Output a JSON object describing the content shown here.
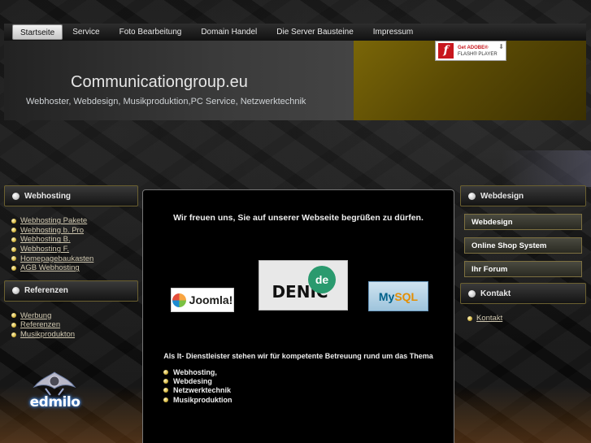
{
  "nav": {
    "items": [
      {
        "label": "Startseite",
        "active": true
      },
      {
        "label": "Service",
        "active": false
      },
      {
        "label": "Foto Bearbeitung",
        "active": false
      },
      {
        "label": "Domain Handel",
        "active": false
      },
      {
        "label": "Die Server Bausteine",
        "active": false
      },
      {
        "label": "Impressum",
        "active": false
      }
    ]
  },
  "header": {
    "title": "Communicationgroup.eu",
    "subtitle": "Webhoster, Webdesign, Musikproduktion,PC Service, Netzwerktechnik",
    "flash_badge": {
      "line1": "Get ADOBE®",
      "line2": "FLASH® PLAYER",
      "icon": "flash-player-icon"
    }
  },
  "left_sidebar": {
    "webhosting": {
      "title": "Webhosting",
      "links": [
        "Webhosting Pakete",
        "Webhosting b. Pro",
        "Webhosting B.",
        "Webhosting F.",
        "Homepagebaukasten",
        "AGB Webhosting"
      ]
    },
    "referenzen": {
      "title": "Referenzen",
      "links": [
        "Werbung",
        "Referenzen",
        "Musikprodukton"
      ]
    },
    "logo_text": "edmilo"
  },
  "main": {
    "welcome": "Wir freuen uns, Sie auf unserer Webseite begrüßen zu dürfen.",
    "partners": {
      "joomla": "Joomla!",
      "denic": "DENIC",
      "denic_badge": "de",
      "mysql_a": "My",
      "mysql_b": "SQL"
    },
    "it_lead": "Als It- Dienstleister stehen wir für kompetente Betreuung rund um das Thema",
    "topics": [
      "Webhosting,",
      "Webdesing",
      "Netzwerktechnik",
      "Musikproduktion"
    ]
  },
  "right_sidebar": {
    "webdesign": {
      "title": "Webdesign",
      "buttons": [
        "Webdesign",
        "Online Shop System",
        "Ihr Forum"
      ]
    },
    "kontakt": {
      "title": "Kontakt",
      "links": [
        "Kontakt"
      ]
    }
  },
  "colors": {
    "accent_gold": "#d4b640",
    "header_gold": "#7a6608",
    "background": "#050505"
  }
}
